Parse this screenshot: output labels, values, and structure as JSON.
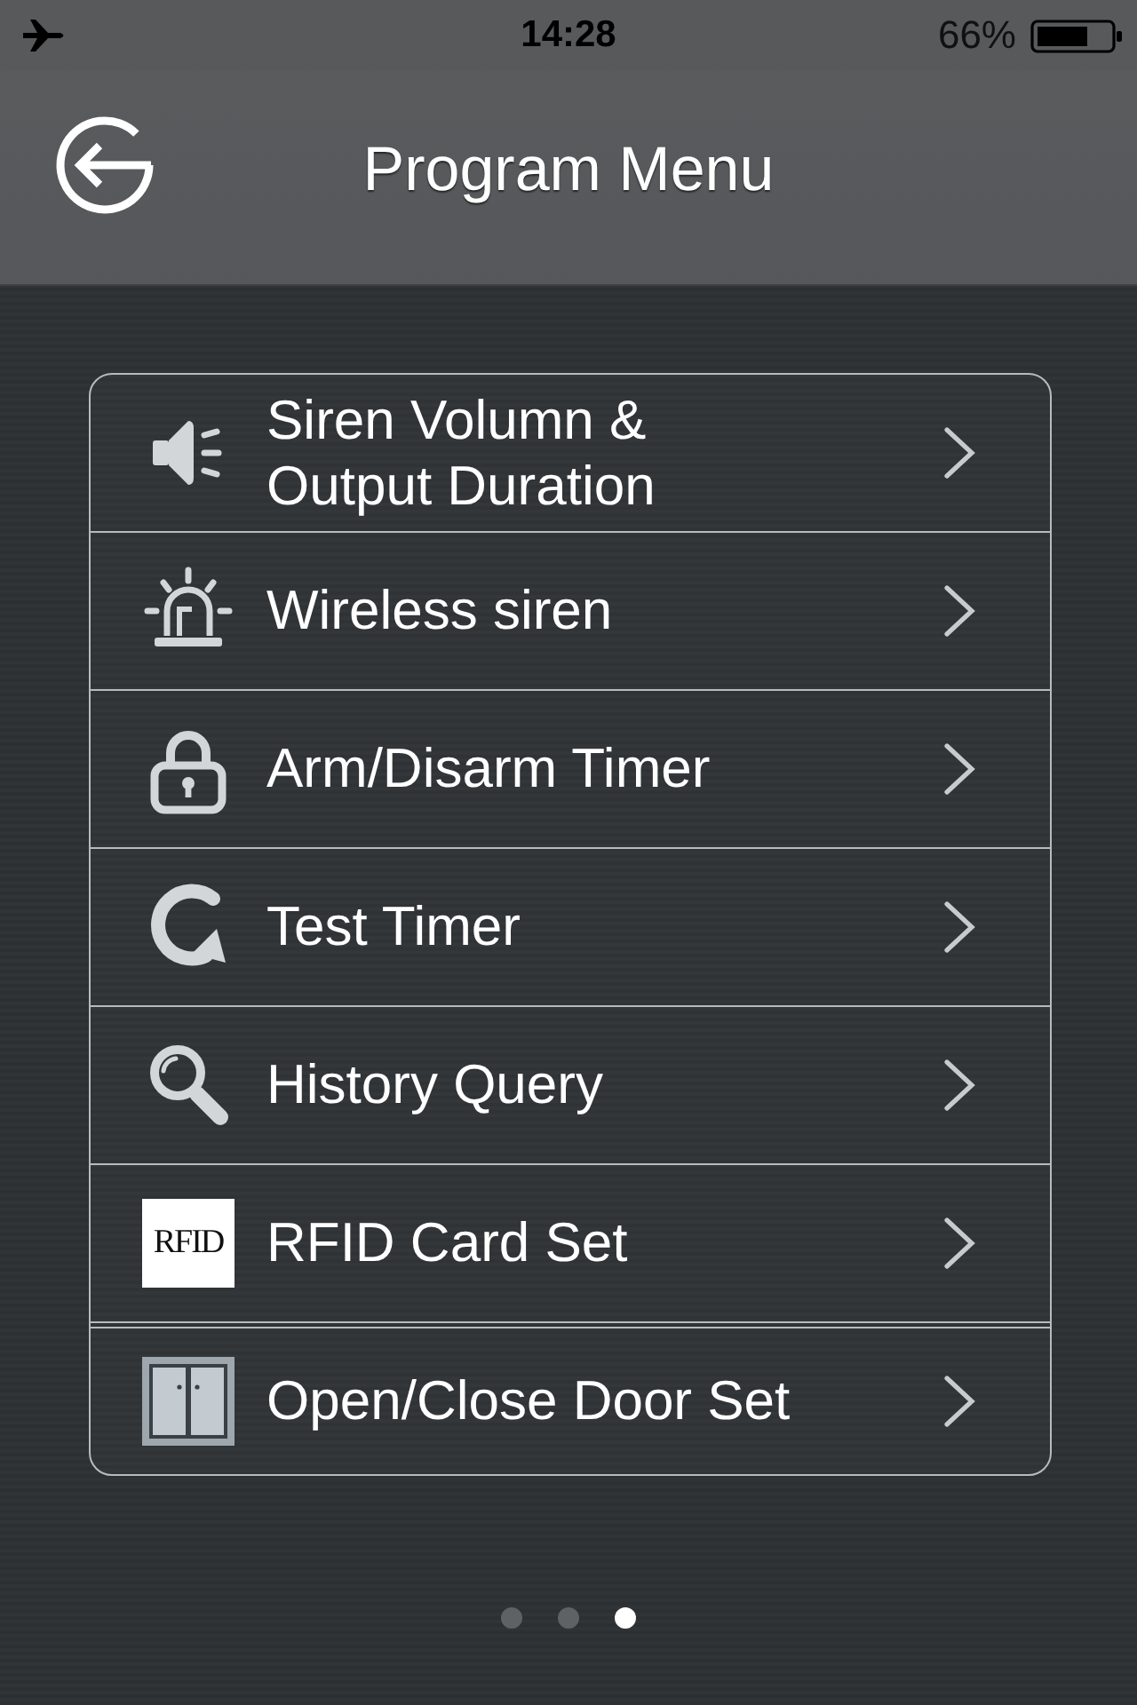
{
  "status_bar": {
    "time": "14:28",
    "battery": "66%"
  },
  "header": {
    "title": "Program Menu"
  },
  "menu": [
    {
      "label": "Siren Volumn &\nOutput Duration"
    },
    {
      "label": "Wireless siren"
    },
    {
      "label": "Arm/Disarm Timer"
    },
    {
      "label": "Test Timer"
    },
    {
      "label": "History Query"
    },
    {
      "label": "RFID Card Set",
      "badge": "RFID"
    },
    {
      "label": "Open/Close Door Set"
    }
  ],
  "pages": [
    {
      "selected": false
    },
    {
      "selected": false
    },
    {
      "selected": true
    }
  ]
}
